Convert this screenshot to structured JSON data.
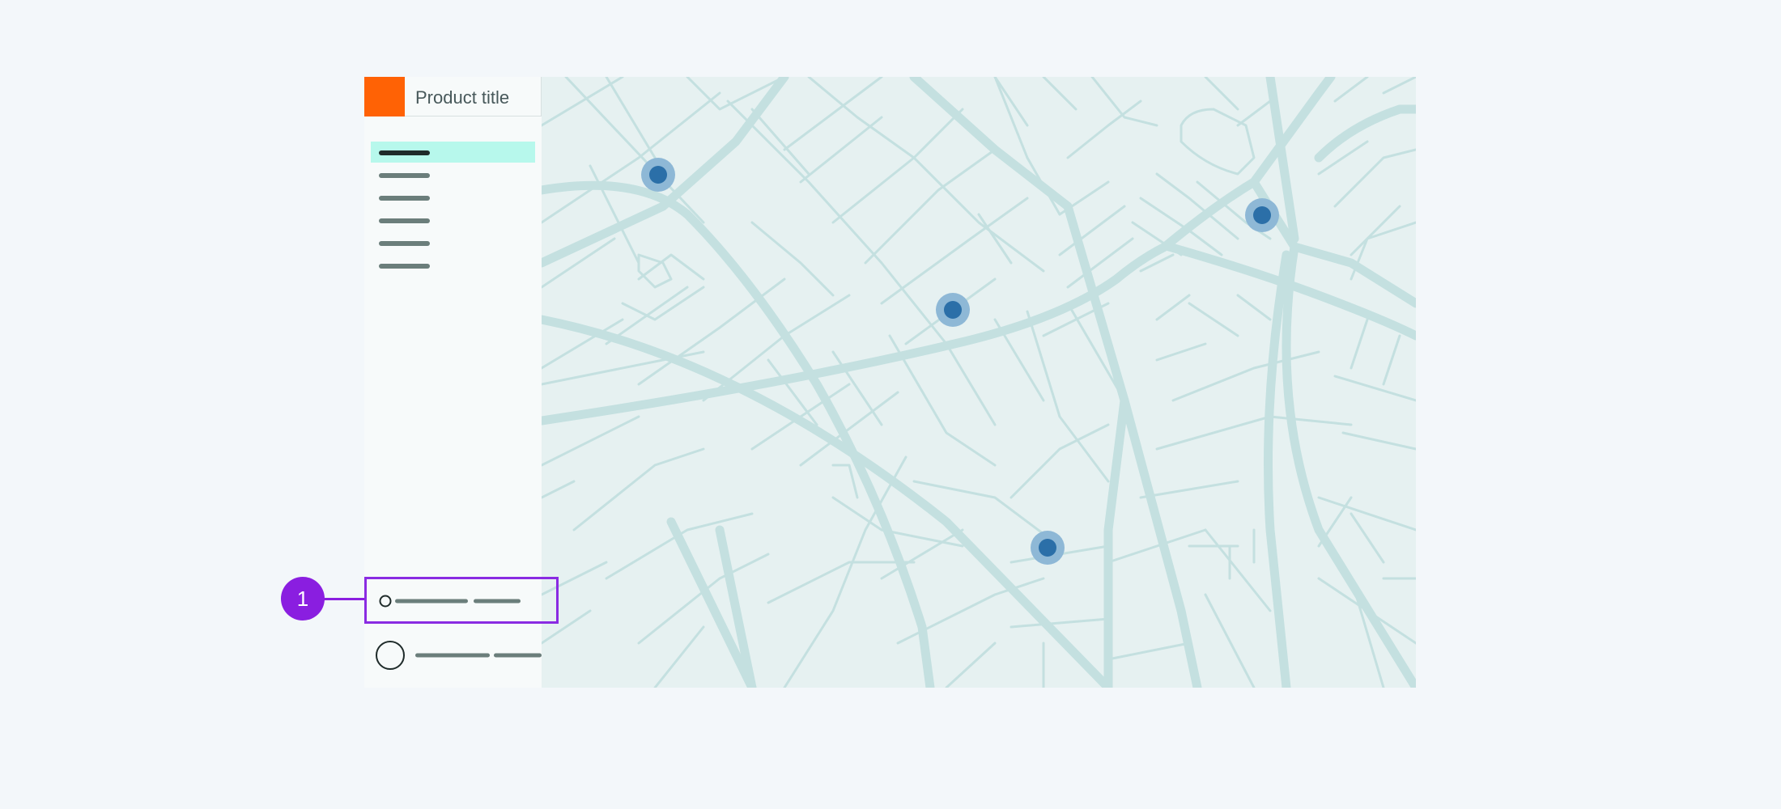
{
  "app": {
    "title": "Product title",
    "brand_color": "#ff6205"
  },
  "sidebar": {
    "items": [
      {
        "active": true
      },
      {
        "active": false
      },
      {
        "active": false
      },
      {
        "active": false
      },
      {
        "active": false
      },
      {
        "active": false
      }
    ],
    "footer": {
      "item_1_icon": "circle-icon-small",
      "item_2_icon": "avatar-circle-icon"
    }
  },
  "callout": {
    "number": "1",
    "color": "#8a1ee0"
  },
  "map": {
    "marker_count": 4,
    "marker_color": "#2b6fa8",
    "road_color": "#c4e0e0"
  }
}
